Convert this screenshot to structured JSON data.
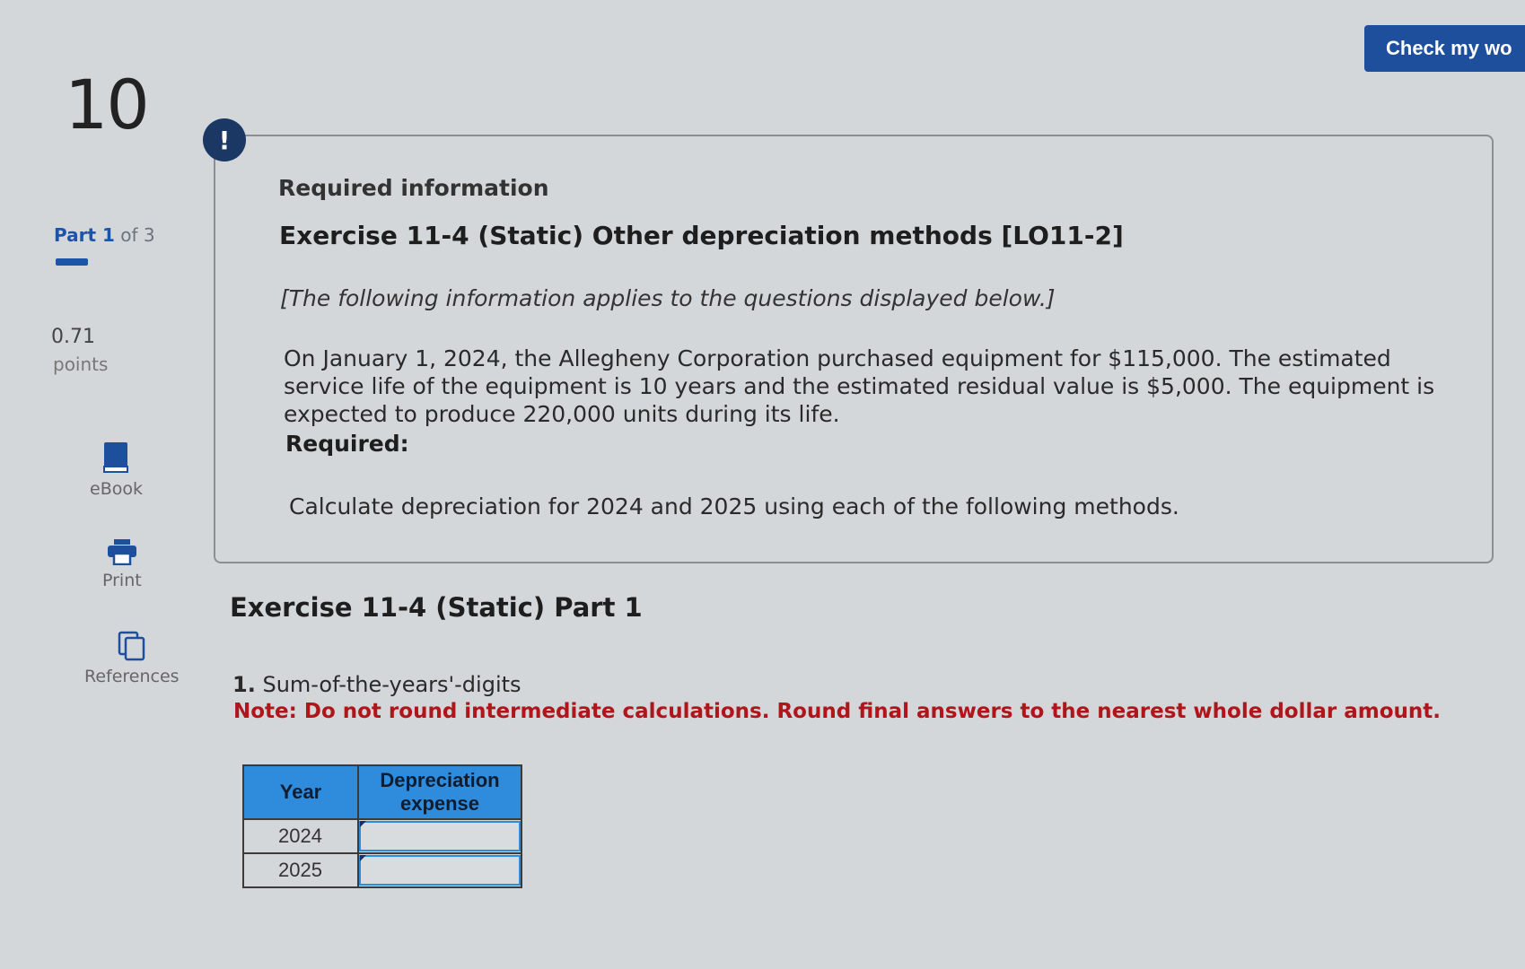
{
  "question": {
    "number": "10"
  },
  "part": {
    "prefix": "Part",
    "current": "1",
    "suffix": "of 3"
  },
  "points": {
    "value": "0.71",
    "label": "points"
  },
  "tools": {
    "ebook": "eBook",
    "print": "Print",
    "references": "References"
  },
  "header": {
    "check_button": "Check my wo"
  },
  "info": {
    "alert_symbol": "!",
    "required_title": "Required information",
    "exercise_title": "Exercise 11-4 (Static) Other depreciation methods [LO11-2]",
    "italic_note": "[The following information applies to the questions displayed below.]",
    "paragraph": "On January 1, 2024, the Allegheny Corporation purchased equipment for $115,000. The estimated service life of the equipment is 10 years and the estimated residual value is $5,000. The equipment is expected to produce 220,000 units during its life.",
    "required_label": "Required:",
    "calculate": "Calculate depreciation for 2024 and 2025 using each of the following methods."
  },
  "part_section": {
    "title": "Exercise 11-4 (Static) Part 1",
    "item_number": "1.",
    "item_text": "Sum-of-the-years'-digits",
    "note": "Note: Do not round intermediate calculations. Round final answers to the nearest whole dollar amount."
  },
  "table": {
    "headers": {
      "year": "Year",
      "depreciation": "Depreciation expense"
    },
    "rows": [
      {
        "year": "2024",
        "value": ""
      },
      {
        "year": "2025",
        "value": ""
      }
    ]
  },
  "colors": {
    "accent": "#1d4f9c",
    "table_header": "#2f8bdc",
    "note_red": "#b0151b"
  }
}
